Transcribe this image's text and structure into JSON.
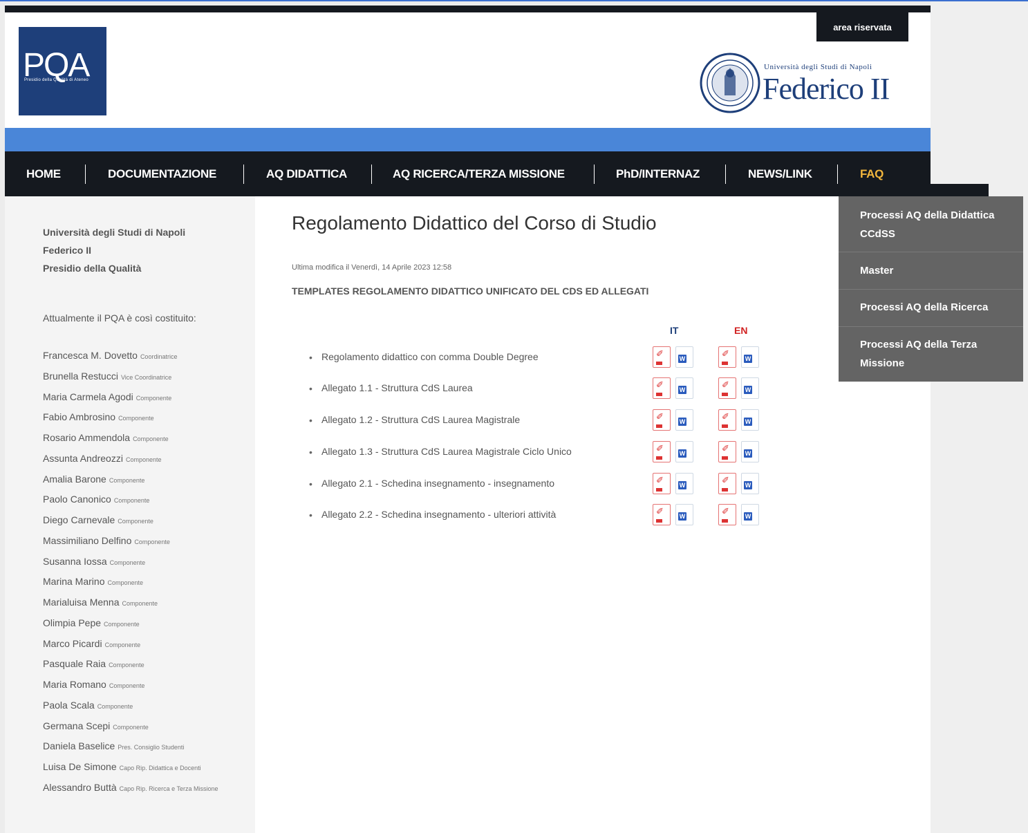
{
  "header": {
    "area_riservata": "area riservata",
    "logo_text": "PQA",
    "logo_subtext": "Presidio della Qualità di Ateneo",
    "university_small": "Università degli Studi di Napoli",
    "university_big": "Federico II"
  },
  "nav": {
    "items": [
      {
        "label": "HOME"
      },
      {
        "label": "DOCUMENTAZIONE"
      },
      {
        "label": "AQ DIDATTICA"
      },
      {
        "label": "AQ RICERCA/TERZA MISSIONE"
      },
      {
        "label": "PhD/INTERNAZ"
      },
      {
        "label": "NEWS/LINK"
      },
      {
        "label": "FAQ"
      }
    ],
    "active_color": "#f2b63d",
    "dropdown": [
      {
        "label": "Processi AQ della Didattica CCdSS"
      },
      {
        "label": "Master"
      },
      {
        "label": "Processi AQ della Ricerca"
      },
      {
        "label": "Processi AQ della Terza Missione"
      }
    ]
  },
  "sidebar": {
    "heading_line1": "Università degli Studi di Napoli",
    "heading_line2": "Federico II",
    "heading_line3": "Presidio della Qualità",
    "intro": "Attualmente il PQA è così costituito:",
    "members": [
      {
        "name": "Francesca M. Dovetto",
        "role": "Coordinatrice"
      },
      {
        "name": "Brunella Restucci",
        "role": "Vice Coordinatrice"
      },
      {
        "name": "Maria Carmela Agodi",
        "role": "Componente"
      },
      {
        "name": "Fabio Ambrosino",
        "role": "Componente"
      },
      {
        "name": "Rosario Ammendola",
        "role": "Componente"
      },
      {
        "name": "Assunta Andreozzi",
        "role": "Componente"
      },
      {
        "name": "Amalia Barone",
        "role": "Componente"
      },
      {
        "name": "Paolo Canonico",
        "role": "Componente"
      },
      {
        "name": "Diego Carnevale",
        "role": "Componente"
      },
      {
        "name": "Massimiliano Delfino",
        "role": "Componente"
      },
      {
        "name": "Susanna Iossa",
        "role": "Componente"
      },
      {
        "name": "Marina Marino",
        "role": "Componente"
      },
      {
        "name": "Marialuisa Menna",
        "role": "Componente"
      },
      {
        "name": "Olimpia Pepe",
        "role": "Componente"
      },
      {
        "name": "Marco Picardi",
        "role": "Componente"
      },
      {
        "name": "Pasquale Raia",
        "role": "Componente"
      },
      {
        "name": "Maria Romano",
        "role": "Componente"
      },
      {
        "name": "Paola Scala",
        "role": "Componente"
      },
      {
        "name": "Germana Scepi",
        "role": "Componente"
      },
      {
        "name": "Daniela Baselice",
        "role": "Pres. Consiglio Studenti"
      },
      {
        "name": "Luisa De Simone",
        "role": "Capo Rip. Didattica e Docenti"
      },
      {
        "name": "Alessandro Buttà",
        "role": "Capo Rip. Ricerca e Terza Missione"
      }
    ]
  },
  "content": {
    "title": "Regolamento Didattico del Corso di Studio",
    "last_modified": "Ultima modifica il Venerdì, 14 Aprile 2023 12:58",
    "templates_heading": "TEMPLATES REGOLAMENTO DIDATTICO UNIFICATO DEL CDS ED ALLEGATI",
    "lang_it": "IT",
    "lang_en": "EN",
    "documents": [
      {
        "label": "Regolamento didattico con comma Double Degree"
      },
      {
        "label": "Allegato 1.1 - Struttura CdS Laurea"
      },
      {
        "label": "Allegato 1.2 - Struttura CdS Laurea Magistrale"
      },
      {
        "label": "Allegato 1.3 - Struttura CdS Laurea Magistrale Ciclo Unico"
      },
      {
        "label": "Allegato 2.1 - Schedina insegnamento - insegnamento"
      },
      {
        "label": "Allegato 2.2 - Schedina insegnamento - ulteriori attività"
      }
    ],
    "file_icons": {
      "pdf": "pdf-file-icon",
      "docx": "word-file-icon"
    }
  }
}
